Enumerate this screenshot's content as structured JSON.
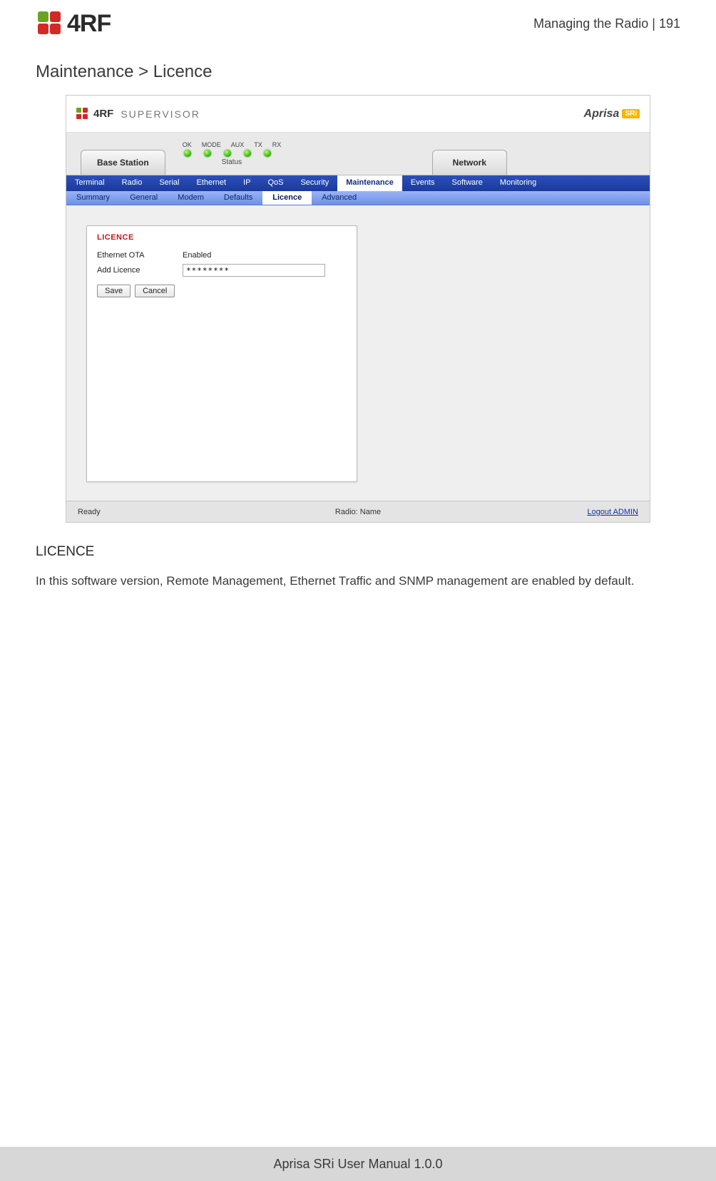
{
  "doc": {
    "brand": "4RF",
    "header_text": "Managing the Radio  |  191",
    "page_title": "Maintenance > Licence",
    "section_heading": "LICENCE",
    "body": "In this software version, Remote Management, Ethernet Traffic and SNMP management are enabled by default.",
    "footer": "Aprisa SRi User Manual 1.0.0"
  },
  "app": {
    "logo_primary": "4RF",
    "logo_secondary": "SUPERVISOR",
    "product_name": "Aprisa",
    "product_badge": "SRi",
    "device_tab": "Base Station",
    "network_tab": "Network",
    "status": {
      "labels": [
        "OK",
        "MODE",
        "AUX",
        "TX",
        "RX"
      ],
      "word": "Status"
    },
    "nav_primary": [
      "Terminal",
      "Radio",
      "Serial",
      "Ethernet",
      "IP",
      "QoS",
      "Security",
      "Maintenance",
      "Events",
      "Software",
      "Monitoring"
    ],
    "nav_primary_active": "Maintenance",
    "nav_secondary": [
      "Summary",
      "General",
      "Modem",
      "Defaults",
      "Licence",
      "Advanced"
    ],
    "nav_secondary_active": "Licence",
    "panel": {
      "title": "LICENCE",
      "rows": {
        "ethernet_ota_label": "Ethernet OTA",
        "ethernet_ota_value": "Enabled",
        "add_licence_label": "Add Licence",
        "add_licence_value": "********"
      },
      "buttons": {
        "save": "Save",
        "cancel": "Cancel"
      }
    },
    "footer": {
      "left": "Ready",
      "mid": "Radio: Name",
      "right": "Logout ADMIN"
    }
  }
}
